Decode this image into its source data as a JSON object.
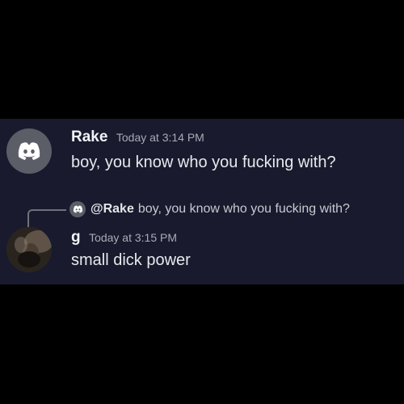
{
  "messages": [
    {
      "author": "Rake",
      "timestamp": "Today at 3:14 PM",
      "text": "boy, you know who you fucking with?",
      "avatar": "discord-logo-icon"
    },
    {
      "author": "g",
      "timestamp": "Today at 3:15 PM",
      "text": "small dick power",
      "avatar": "user-photo",
      "reply": {
        "mention": "@Rake",
        "text": "boy, you know who you fucking with?",
        "avatar": "discord-logo-icon"
      }
    }
  ],
  "colors": {
    "background": "#000000",
    "panel": "#191a2e",
    "username": "#f2f3f5",
    "timestamp": "#a9abb4",
    "text": "#e8e9ec",
    "default_avatar": "#5c5e67"
  }
}
